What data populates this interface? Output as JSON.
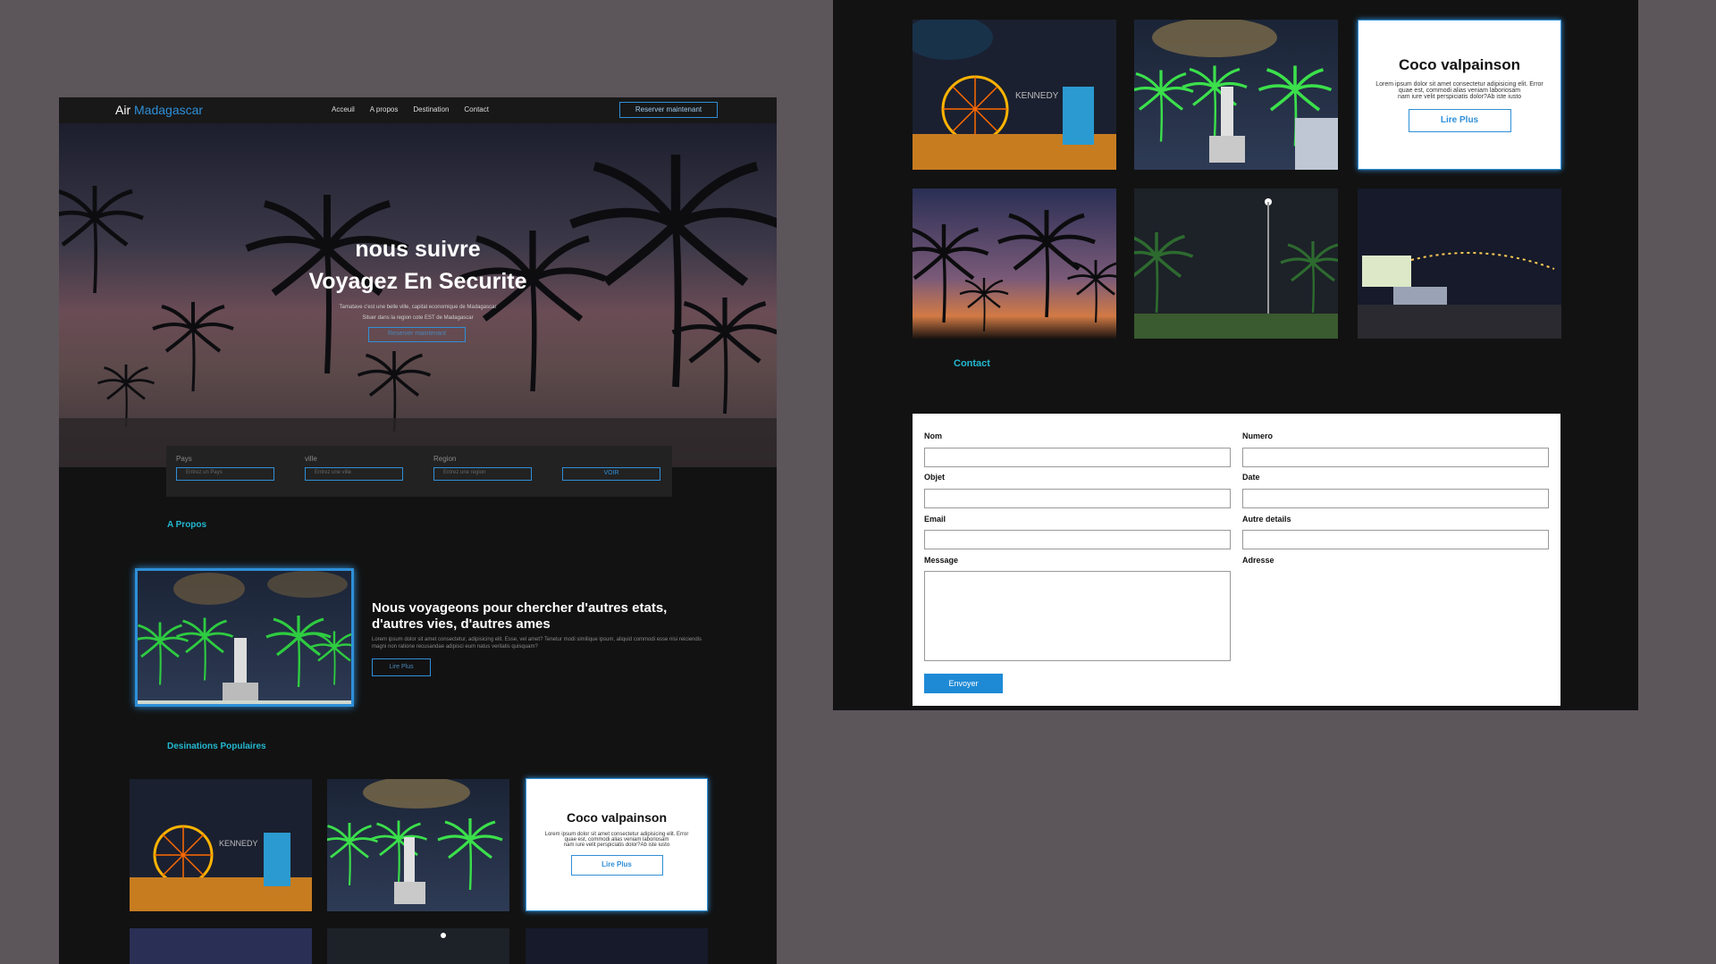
{
  "brand": {
    "prefix": "Air",
    "name": "Madagascar"
  },
  "nav": {
    "links": [
      "Acceuil",
      "A propos",
      "Destination",
      "Contact"
    ],
    "cta": "Reserver maintenant"
  },
  "hero": {
    "line1": "nous suivre",
    "line2": "Voyagez En Securite",
    "sub1": "Tamatave c'est une belle ville, capital economique de Madagascar",
    "sub2": "Situer dans la region cote EST de Madagascar",
    "cta": "Reserver maintenant"
  },
  "search": {
    "fields": [
      {
        "label": "Pays",
        "placeholder": "Entrez un Pays"
      },
      {
        "label": "ville",
        "placeholder": "Entrez une ville"
      },
      {
        "label": "Region",
        "placeholder": "Entrez une region"
      }
    ],
    "button": "VOIR"
  },
  "about": {
    "section": "A Propos",
    "heading": "Nous voyageons pour chercher d'autres etats, d'autres vies, d'autres ames",
    "text": "Lorem ipsum dolor sit amet consectetur, adipisicing elit. Esse, vel amet? Tenetur modi similique ipsum, aliquid commodi esse nisi reiciendis magni non ratione recusandae adipisci eum natus veritatis quisquam?",
    "button": "Lire Plus"
  },
  "destinations": {
    "section": "Desinations Populaires",
    "card": {
      "title": "Coco valpainson",
      "line1": "Lorem ipsum dolor sit amet consectetur adipisicing elit. Error",
      "line2": "quae est, commodi alias veniam laboriosam",
      "line3": "nam iure velit perspiciatis dolor?Ab iste iusto",
      "button": "Lire Plus"
    }
  },
  "contact": {
    "section": "Contact",
    "fields": {
      "nom": "Nom",
      "numero": "Numero",
      "objet": "Objet",
      "date": "Date",
      "email": "Email",
      "autre": "Autre details",
      "message": "Message",
      "adresse": "Adresse"
    },
    "submit": "Envoyer"
  },
  "watermark": "KENNEDY"
}
